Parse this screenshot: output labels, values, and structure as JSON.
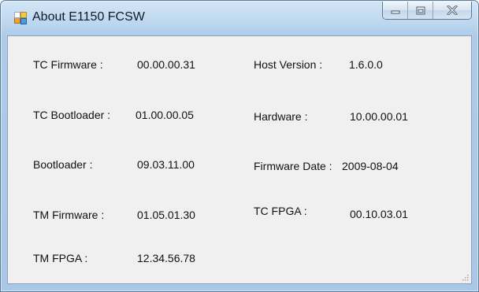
{
  "window": {
    "title": "About E1150 FCSW",
    "icon": "application-icon",
    "controls": {
      "minimize": "minimize-icon",
      "maximize": "maximize-icon",
      "close": "close-icon"
    }
  },
  "fields": {
    "tc_firmware": {
      "label": "TC Firmware :",
      "value": "00.00.00.31"
    },
    "tc_bootloader": {
      "label": "TC Bootloader :",
      "value": "01.00.00.05"
    },
    "bootloader": {
      "label": "Bootloader :",
      "value": "09.03.11.00"
    },
    "tm_firmware": {
      "label": "TM Firmware :",
      "value": "01.05.01.30"
    },
    "tm_fpga": {
      "label": "TM FPGA :",
      "value": "12.34.56.78"
    },
    "host_version": {
      "label": "Host Version :",
      "value": "1.6.0.0"
    },
    "hardware": {
      "label": "Hardware :",
      "value": "10.00.00.01"
    },
    "firmware_date": {
      "label": "Firmware Date :",
      "value": "2009-08-04"
    },
    "tc_fpga": {
      "label": "TC FPGA :",
      "value": "00.10.03.01"
    }
  }
}
